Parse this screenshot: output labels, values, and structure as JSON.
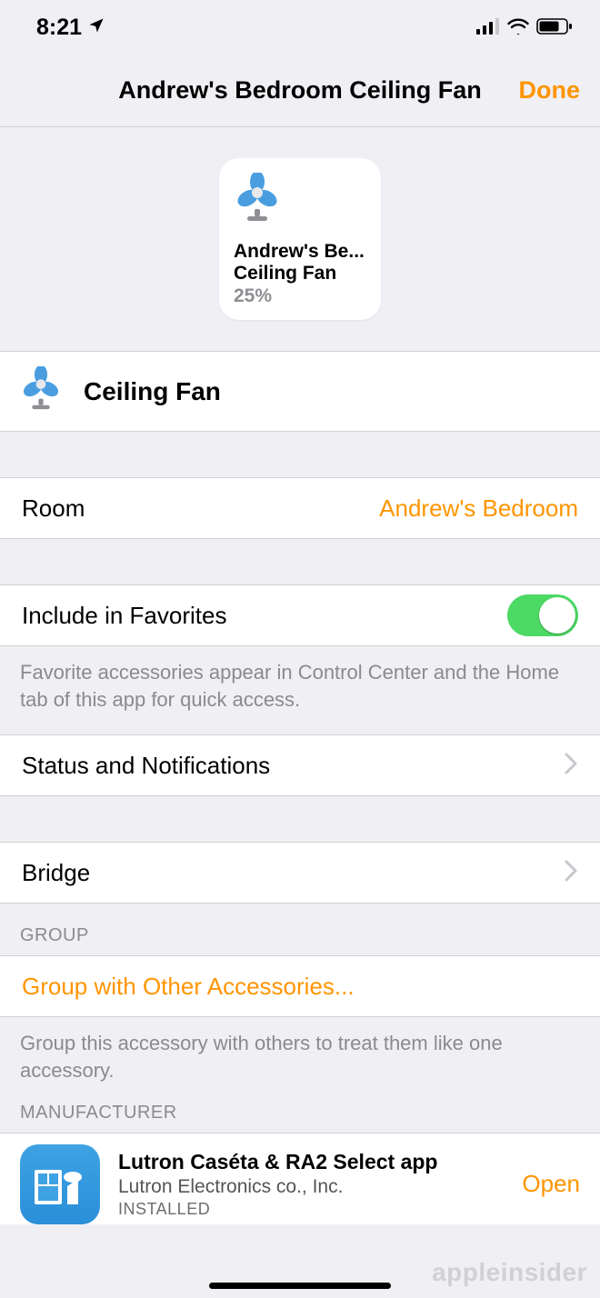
{
  "status": {
    "time": "8:21"
  },
  "nav": {
    "title": "Andrew's Bedroom Ceiling Fan",
    "done": "Done"
  },
  "tile": {
    "line1": "Andrew's Be...",
    "line2": "Ceiling Fan",
    "percent": "25%"
  },
  "device": {
    "name": "Ceiling Fan"
  },
  "room": {
    "label": "Room",
    "value": "Andrew's Bedroom"
  },
  "favorites": {
    "label": "Include in Favorites",
    "on": true,
    "footer": "Favorite accessories appear in Control Center and the Home tab of this app for quick access."
  },
  "status_notifications": {
    "label": "Status and Notifications"
  },
  "bridge": {
    "label": "Bridge"
  },
  "group": {
    "header": "GROUP",
    "action": "Group with Other Accessories...",
    "footer": "Group this accessory with others to treat them like one accessory."
  },
  "manufacturer": {
    "header": "MANUFACTURER",
    "app_name": "Lutron Caséta & RA2 Select app",
    "company": "Lutron Electronics co., Inc.",
    "installed": "INSTALLED",
    "open": "Open"
  },
  "watermark": "appleinsider"
}
